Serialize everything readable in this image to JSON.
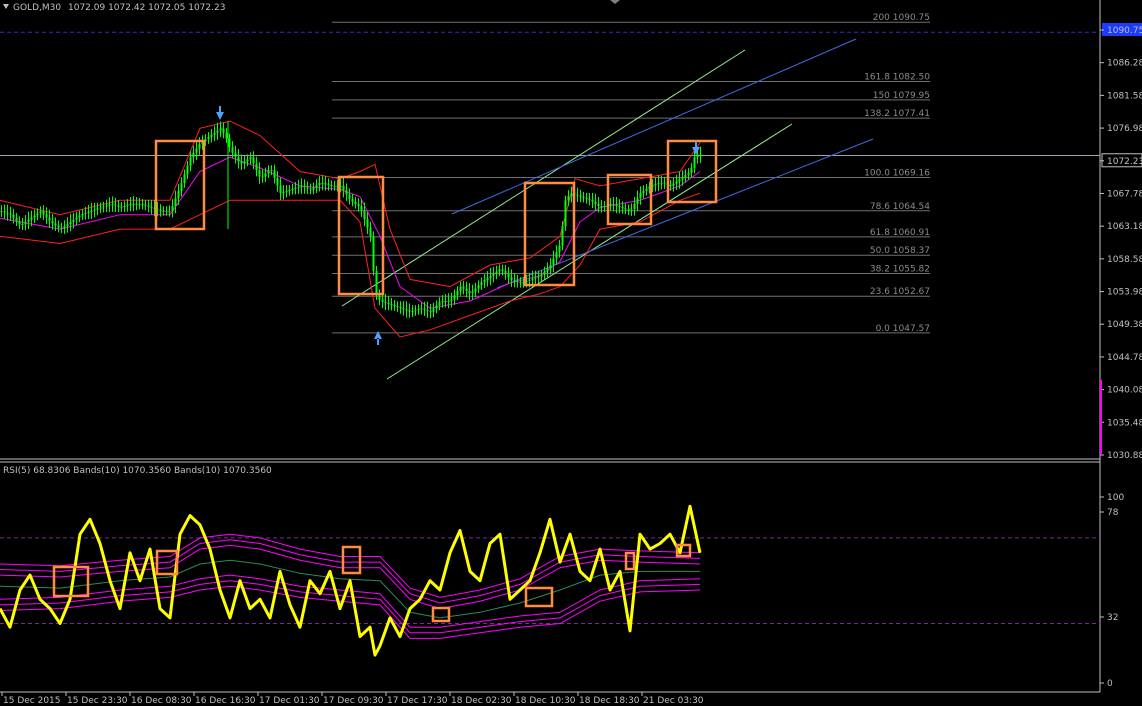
{
  "header": {
    "symbol": "GOLD,M30",
    "ohlc": "1072.09 1072.42 1072.05 1072.23"
  },
  "indicator_header": {
    "text": "RSI(5) 68.8306 Bands(10) 1070.3560 Bands(10) 1070.3560"
  },
  "colors": {
    "background": "#000000",
    "candle": "#00ff00",
    "rsi": "#ffff00",
    "bb_upper": "#ff2020",
    "bb_middle": "#ff00ff",
    "channel_green": "#90ee90",
    "channel_blue": "#4169e1",
    "box": "#ff8c42",
    "fib": "#707070",
    "arrow": "#4aa3ff"
  },
  "chart_data": [
    {
      "type": "candlestick",
      "title": "GOLD,M30",
      "price_axis_ticks": [
        "1090.75",
        "1086.28",
        "1081.58",
        "1076.98",
        "1072.23",
        "1067.78",
        "1063.18",
        "1058.58",
        "1053.98",
        "1049.38",
        "1044.78",
        "1040.08",
        "1035.48",
        "1030.88"
      ],
      "current_price": 1072.23,
      "ylim": [
        1030.88,
        1093.0
      ],
      "fibonacci_levels": [
        {
          "label": "200 1090.75",
          "price": 1090.75
        },
        {
          "label": "161.8 1082.50",
          "price": 1082.5
        },
        {
          "label": "150 1079.95",
          "price": 1079.95
        },
        {
          "label": "138.2 1077.41",
          "price": 1077.41
        },
        {
          "label": "100.0 1069.16",
          "price": 1069.16
        },
        {
          "label": "78.6 1064.54",
          "price": 1064.54
        },
        {
          "label": "61.8 1060.91",
          "price": 1060.91
        },
        {
          "label": "50.0 1058.37",
          "price": 1058.37
        },
        {
          "label": "38.2 1055.82",
          "price": 1055.82
        },
        {
          "label": "23.6 1052.67",
          "price": 1052.67
        },
        {
          "label": "0.0 1047.57",
          "price": 1047.57
        }
      ],
      "price_path": [
        [
          0,
          1064.5
        ],
        [
          10,
          1064.0
        ],
        [
          20,
          1062.5
        ],
        [
          30,
          1063.5
        ],
        [
          40,
          1064.5
        ],
        [
          50,
          1063.0
        ],
        [
          60,
          1062.0
        ],
        [
          70,
          1063.0
        ],
        [
          80,
          1064.0
        ],
        [
          90,
          1064.5
        ],
        [
          100,
          1065.0
        ],
        [
          110,
          1065.5
        ],
        [
          120,
          1065.0
        ],
        [
          130,
          1065.5
        ],
        [
          140,
          1065.5
        ],
        [
          150,
          1065.0
        ],
        [
          160,
          1064.5
        ],
        [
          170,
          1064.5
        ],
        [
          180,
          1068.0
        ],
        [
          190,
          1072.0
        ],
        [
          200,
          1074.0
        ],
        [
          210,
          1075.0
        ],
        [
          220,
          1076.0
        ],
        [
          225,
          1075.0
        ],
        [
          230,
          1073.0
        ],
        [
          240,
          1071.0
        ],
        [
          250,
          1072.0
        ],
        [
          260,
          1069.0
        ],
        [
          270,
          1070.5
        ],
        [
          280,
          1067.0
        ],
        [
          290,
          1067.5
        ],
        [
          300,
          1068.0
        ],
        [
          310,
          1067.5
        ],
        [
          320,
          1068.5
        ],
        [
          330,
          1068.0
        ],
        [
          340,
          1068.0
        ],
        [
          350,
          1066.0
        ],
        [
          360,
          1065.0
        ],
        [
          370,
          1061.0
        ],
        [
          375,
          1053.0
        ],
        [
          380,
          1052.0
        ],
        [
          390,
          1051.5
        ],
        [
          400,
          1051.0
        ],
        [
          410,
          1050.5
        ],
        [
          420,
          1051.0
        ],
        [
          430,
          1050.5
        ],
        [
          440,
          1052.0
        ],
        [
          450,
          1052.0
        ],
        [
          460,
          1054.0
        ],
        [
          470,
          1053.0
        ],
        [
          480,
          1054.5
        ],
        [
          490,
          1055.5
        ],
        [
          500,
          1056.5
        ],
        [
          510,
          1055.0
        ],
        [
          520,
          1054.5
        ],
        [
          530,
          1055.0
        ],
        [
          540,
          1055.5
        ],
        [
          550,
          1057.0
        ],
        [
          560,
          1060.0
        ],
        [
          565,
          1066.0
        ],
        [
          570,
          1067.0
        ],
        [
          580,
          1066.5
        ],
        [
          590,
          1066.0
        ],
        [
          600,
          1065.0
        ],
        [
          610,
          1065.5
        ],
        [
          620,
          1065.0
        ],
        [
          630,
          1064.5
        ],
        [
          640,
          1067.0
        ],
        [
          650,
          1068.0
        ],
        [
          660,
          1068.5
        ],
        [
          670,
          1068.0
        ],
        [
          680,
          1069.0
        ],
        [
          690,
          1070.0
        ],
        [
          695,
          1072.5
        ],
        [
          700,
          1072.2
        ]
      ],
      "bb_upper": [
        [
          0,
          1066
        ],
        [
          60,
          1064
        ],
        [
          120,
          1066
        ],
        [
          170,
          1066
        ],
        [
          200,
          1076
        ],
        [
          230,
          1077
        ],
        [
          260,
          1075
        ],
        [
          300,
          1070
        ],
        [
          340,
          1069
        ],
        [
          360,
          1070
        ],
        [
          375,
          1071
        ],
        [
          390,
          1062
        ],
        [
          410,
          1055
        ],
        [
          450,
          1054
        ],
        [
          490,
          1057
        ],
        [
          530,
          1058
        ],
        [
          560,
          1061
        ],
        [
          575,
          1069
        ],
        [
          600,
          1068
        ],
        [
          640,
          1069
        ],
        [
          680,
          1070
        ],
        [
          700,
          1074
        ]
      ],
      "bb_lower": [
        [
          0,
          1061
        ],
        [
          60,
          1060
        ],
        [
          120,
          1062
        ],
        [
          170,
          1062
        ],
        [
          200,
          1064
        ],
        [
          230,
          1066
        ],
        [
          260,
          1066
        ],
        [
          300,
          1066
        ],
        [
          340,
          1066
        ],
        [
          360,
          1063
        ],
        [
          375,
          1051
        ],
        [
          400,
          1047
        ],
        [
          430,
          1048
        ],
        [
          470,
          1050
        ],
        [
          510,
          1052
        ],
        [
          540,
          1053
        ],
        [
          560,
          1054
        ],
        [
          580,
          1057
        ],
        [
          600,
          1062
        ],
        [
          640,
          1063
        ],
        [
          680,
          1066
        ],
        [
          700,
          1067
        ]
      ],
      "bb_middle": [
        [
          0,
          1063.5
        ],
        [
          60,
          1062
        ],
        [
          120,
          1064
        ],
        [
          170,
          1064
        ],
        [
          200,
          1070
        ],
        [
          230,
          1072
        ],
        [
          260,
          1070.5
        ],
        [
          300,
          1068
        ],
        [
          340,
          1067.5
        ],
        [
          360,
          1066.5
        ],
        [
          380,
          1061
        ],
        [
          400,
          1054
        ],
        [
          430,
          1051
        ],
        [
          470,
          1052
        ],
        [
          510,
          1054.5
        ],
        [
          540,
          1055.5
        ],
        [
          560,
          1057.5
        ],
        [
          580,
          1063
        ],
        [
          600,
          1065
        ],
        [
          640,
          1066
        ],
        [
          680,
          1068
        ],
        [
          700,
          1070
        ]
      ]
    },
    {
      "type": "line",
      "title": "RSI(5) 68.8306 Bands(10) 1070.3560 Bands(10) 1070.3560",
      "ylim": [
        0,
        100
      ],
      "level_ticks": [
        "100",
        "78",
        "32",
        "0"
      ],
      "x_labels": [
        "15 Dec 2015",
        "15 Dec 23:30",
        "16 Dec 08:30",
        "16 Dec 16:30",
        "17 Dec 01:30",
        "17 Dec 09:30",
        "17 Dec 17:30",
        "18 Dec 02:30",
        "18 Dec 10:30",
        "18 Dec 18:30",
        "21 Dec 03:30"
      ],
      "rsi": [
        [
          0,
          40
        ],
        [
          10,
          30
        ],
        [
          20,
          50
        ],
        [
          30,
          58
        ],
        [
          40,
          45
        ],
        [
          50,
          40
        ],
        [
          60,
          32
        ],
        [
          70,
          45
        ],
        [
          80,
          80
        ],
        [
          90,
          88
        ],
        [
          100,
          75
        ],
        [
          110,
          55
        ],
        [
          120,
          40
        ],
        [
          130,
          70
        ],
        [
          140,
          55
        ],
        [
          150,
          72
        ],
        [
          160,
          40
        ],
        [
          170,
          35
        ],
        [
          180,
          80
        ],
        [
          190,
          90
        ],
        [
          200,
          85
        ],
        [
          210,
          72
        ],
        [
          220,
          50
        ],
        [
          230,
          35
        ],
        [
          240,
          55
        ],
        [
          250,
          40
        ],
        [
          260,
          45
        ],
        [
          270,
          35
        ],
        [
          280,
          60
        ],
        [
          290,
          42
        ],
        [
          300,
          30
        ],
        [
          310,
          55
        ],
        [
          320,
          48
        ],
        [
          330,
          60
        ],
        [
          340,
          40
        ],
        [
          350,
          55
        ],
        [
          360,
          25
        ],
        [
          370,
          30
        ],
        [
          375,
          15
        ],
        [
          380,
          20
        ],
        [
          390,
          35
        ],
        [
          400,
          25
        ],
        [
          410,
          40
        ],
        [
          420,
          45
        ],
        [
          430,
          55
        ],
        [
          440,
          50
        ],
        [
          450,
          70
        ],
        [
          460,
          82
        ],
        [
          470,
          60
        ],
        [
          480,
          55
        ],
        [
          490,
          75
        ],
        [
          500,
          80
        ],
        [
          510,
          45
        ],
        [
          520,
          50
        ],
        [
          530,
          55
        ],
        [
          540,
          70
        ],
        [
          550,
          88
        ],
        [
          560,
          65
        ],
        [
          570,
          80
        ],
        [
          580,
          60
        ],
        [
          590,
          55
        ],
        [
          600,
          72
        ],
        [
          610,
          50
        ],
        [
          620,
          60
        ],
        [
          630,
          28
        ],
        [
          640,
          80
        ],
        [
          650,
          72
        ],
        [
          660,
          75
        ],
        [
          670,
          80
        ],
        [
          680,
          70
        ],
        [
          690,
          95
        ],
        [
          700,
          70
        ]
      ],
      "rsi_upper_band": [
        [
          0,
          58
        ],
        [
          60,
          57
        ],
        [
          120,
          60
        ],
        [
          170,
          62
        ],
        [
          200,
          72
        ],
        [
          230,
          74
        ],
        [
          260,
          72
        ],
        [
          300,
          66
        ],
        [
          340,
          62
        ],
        [
          380,
          62
        ],
        [
          410,
          45
        ],
        [
          440,
          40
        ],
        [
          480,
          44
        ],
        [
          520,
          50
        ],
        [
          560,
          62
        ],
        [
          600,
          66
        ],
        [
          640,
          65
        ],
        [
          700,
          64
        ]
      ],
      "rsi_lower_band": [
        [
          0,
          45
        ],
        [
          60,
          46
        ],
        [
          120,
          50
        ],
        [
          170,
          52
        ],
        [
          200,
          56
        ],
        [
          230,
          58
        ],
        [
          260,
          56
        ],
        [
          300,
          52
        ],
        [
          340,
          50
        ],
        [
          380,
          48
        ],
        [
          410,
          30
        ],
        [
          440,
          30
        ],
        [
          480,
          33
        ],
        [
          520,
          36
        ],
        [
          560,
          38
        ],
        [
          600,
          50
        ],
        [
          640,
          55
        ],
        [
          700,
          56
        ]
      ],
      "rsi_middle": [
        [
          0,
          52
        ],
        [
          60,
          51
        ],
        [
          120,
          55
        ],
        [
          170,
          57
        ],
        [
          200,
          64
        ],
        [
          230,
          66
        ],
        [
          260,
          64
        ],
        [
          300,
          59
        ],
        [
          340,
          56
        ],
        [
          380,
          55
        ],
        [
          410,
          38
        ],
        [
          440,
          35
        ],
        [
          480,
          38
        ],
        [
          520,
          43
        ],
        [
          560,
          50
        ],
        [
          600,
          58
        ],
        [
          640,
          60
        ],
        [
          700,
          60
        ]
      ]
    }
  ]
}
